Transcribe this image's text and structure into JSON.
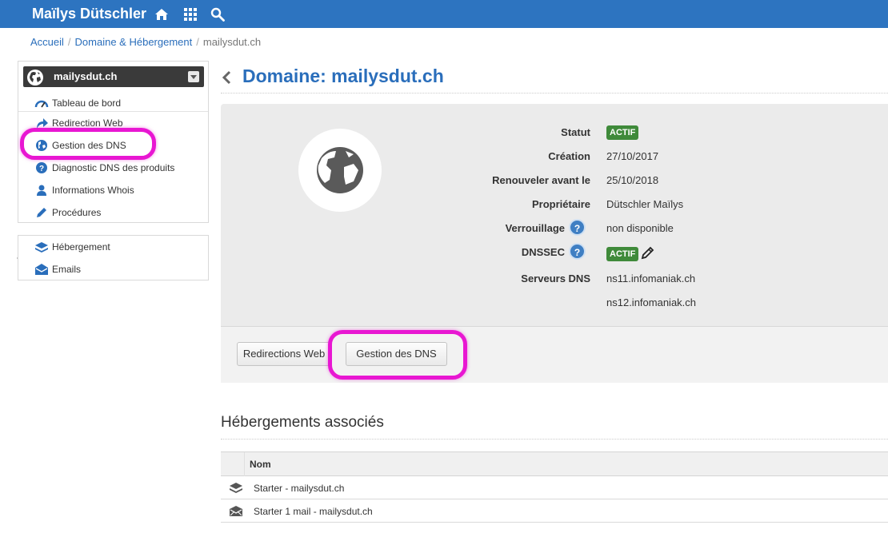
{
  "topbar": {
    "brand": "Maïlys Dütschler",
    "icons": [
      "home-icon",
      "apps-grid-icon",
      "search-icon"
    ],
    "color": "#2d74c0"
  },
  "breadcrumb": {
    "items": [
      "Accueil",
      "Domaine & Hébergement",
      "mailysdut.ch"
    ]
  },
  "sidebar": {
    "domain_select": "mailysdut.ch",
    "items": [
      {
        "label": "Tableau de bord",
        "icon": "dashboard-gauge-icon"
      },
      {
        "label": "Redirection Web",
        "icon": "redirect-arrow-icon"
      },
      {
        "label": "Gestion des DNS",
        "icon": "globe-icon"
      },
      {
        "label": "Diagnostic DNS des produits",
        "icon": "question-circle-icon"
      },
      {
        "label": "Informations Whois",
        "icon": "user-icon"
      },
      {
        "label": "Procédures",
        "icon": "pencil-icon"
      }
    ],
    "products": [
      {
        "label": "Hébergement",
        "icon": "hosting-stack-icon"
      },
      {
        "label": "Emails",
        "icon": "envelope-icon"
      }
    ]
  },
  "main": {
    "title": "Domaine: mailysdut.ch",
    "properties": {
      "statut_label": "Statut",
      "statut_value": "ACTIF",
      "creation_label": "Création",
      "creation_value": "27/10/2017",
      "renew_label": "Renouveler avant le",
      "renew_value": "25/10/2018",
      "owner_label": "Propriétaire",
      "owner_value": "Dütschler Maïlys",
      "lock_label": "Verrouillage",
      "lock_value": "non disponible",
      "dnssec_label": "DNSSEC",
      "dnssec_value": "ACTIF",
      "dns_label": "Serveurs DNS",
      "dns_1": "ns11.infomaniak.ch",
      "dns_2": "ns12.infomaniak.ch"
    },
    "help_glyph": "?",
    "buttons": {
      "redirections": "Redirections Web",
      "dns": "Gestion des DNS"
    },
    "hosting_section": {
      "title": "Hébergements associés",
      "column": "Nom",
      "rows": [
        {
          "name": "Starter - mailysdut.ch",
          "icon": "hosting-stack-icon"
        },
        {
          "name": "Starter 1 mail - mailysdut.ch",
          "icon": "envelope-icon"
        }
      ]
    }
  },
  "colors": {
    "link": "#2a6ebb",
    "badge_green": "#3f8a3a",
    "highlight": "#e817d2"
  }
}
